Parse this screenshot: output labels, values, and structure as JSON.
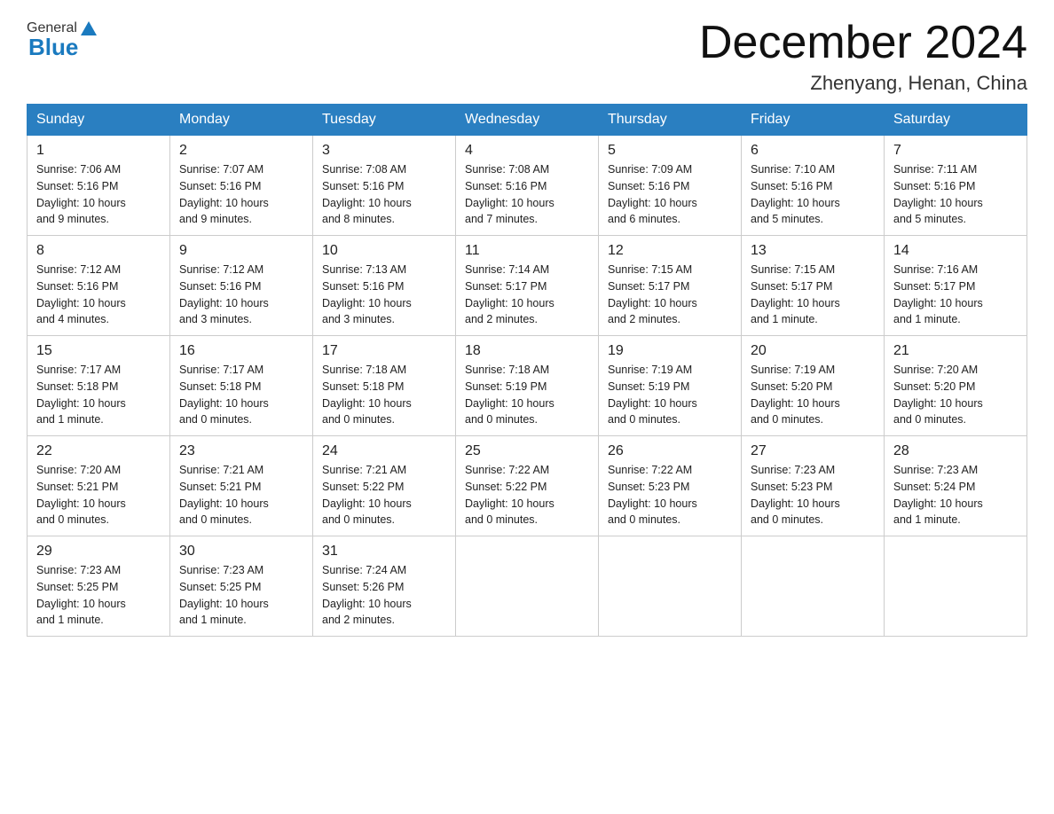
{
  "header": {
    "title": "December 2024",
    "location": "Zhenyang, Henan, China",
    "logo_general": "General",
    "logo_blue": "Blue"
  },
  "days_of_week": [
    "Sunday",
    "Monday",
    "Tuesday",
    "Wednesday",
    "Thursday",
    "Friday",
    "Saturday"
  ],
  "weeks": [
    [
      {
        "day": "1",
        "sunrise": "7:06 AM",
        "sunset": "5:16 PM",
        "daylight": "10 hours and 9 minutes."
      },
      {
        "day": "2",
        "sunrise": "7:07 AM",
        "sunset": "5:16 PM",
        "daylight": "10 hours and 9 minutes."
      },
      {
        "day": "3",
        "sunrise": "7:08 AM",
        "sunset": "5:16 PM",
        "daylight": "10 hours and 8 minutes."
      },
      {
        "day": "4",
        "sunrise": "7:08 AM",
        "sunset": "5:16 PM",
        "daylight": "10 hours and 7 minutes."
      },
      {
        "day": "5",
        "sunrise": "7:09 AM",
        "sunset": "5:16 PM",
        "daylight": "10 hours and 6 minutes."
      },
      {
        "day": "6",
        "sunrise": "7:10 AM",
        "sunset": "5:16 PM",
        "daylight": "10 hours and 5 minutes."
      },
      {
        "day": "7",
        "sunrise": "7:11 AM",
        "sunset": "5:16 PM",
        "daylight": "10 hours and 5 minutes."
      }
    ],
    [
      {
        "day": "8",
        "sunrise": "7:12 AM",
        "sunset": "5:16 PM",
        "daylight": "10 hours and 4 minutes."
      },
      {
        "day": "9",
        "sunrise": "7:12 AM",
        "sunset": "5:16 PM",
        "daylight": "10 hours and 3 minutes."
      },
      {
        "day": "10",
        "sunrise": "7:13 AM",
        "sunset": "5:16 PM",
        "daylight": "10 hours and 3 minutes."
      },
      {
        "day": "11",
        "sunrise": "7:14 AM",
        "sunset": "5:17 PM",
        "daylight": "10 hours and 2 minutes."
      },
      {
        "day": "12",
        "sunrise": "7:15 AM",
        "sunset": "5:17 PM",
        "daylight": "10 hours and 2 minutes."
      },
      {
        "day": "13",
        "sunrise": "7:15 AM",
        "sunset": "5:17 PM",
        "daylight": "10 hours and 1 minute."
      },
      {
        "day": "14",
        "sunrise": "7:16 AM",
        "sunset": "5:17 PM",
        "daylight": "10 hours and 1 minute."
      }
    ],
    [
      {
        "day": "15",
        "sunrise": "7:17 AM",
        "sunset": "5:18 PM",
        "daylight": "10 hours and 1 minute."
      },
      {
        "day": "16",
        "sunrise": "7:17 AM",
        "sunset": "5:18 PM",
        "daylight": "10 hours and 0 minutes."
      },
      {
        "day": "17",
        "sunrise": "7:18 AM",
        "sunset": "5:18 PM",
        "daylight": "10 hours and 0 minutes."
      },
      {
        "day": "18",
        "sunrise": "7:18 AM",
        "sunset": "5:19 PM",
        "daylight": "10 hours and 0 minutes."
      },
      {
        "day": "19",
        "sunrise": "7:19 AM",
        "sunset": "5:19 PM",
        "daylight": "10 hours and 0 minutes."
      },
      {
        "day": "20",
        "sunrise": "7:19 AM",
        "sunset": "5:20 PM",
        "daylight": "10 hours and 0 minutes."
      },
      {
        "day": "21",
        "sunrise": "7:20 AM",
        "sunset": "5:20 PM",
        "daylight": "10 hours and 0 minutes."
      }
    ],
    [
      {
        "day": "22",
        "sunrise": "7:20 AM",
        "sunset": "5:21 PM",
        "daylight": "10 hours and 0 minutes."
      },
      {
        "day": "23",
        "sunrise": "7:21 AM",
        "sunset": "5:21 PM",
        "daylight": "10 hours and 0 minutes."
      },
      {
        "day": "24",
        "sunrise": "7:21 AM",
        "sunset": "5:22 PM",
        "daylight": "10 hours and 0 minutes."
      },
      {
        "day": "25",
        "sunrise": "7:22 AM",
        "sunset": "5:22 PM",
        "daylight": "10 hours and 0 minutes."
      },
      {
        "day": "26",
        "sunrise": "7:22 AM",
        "sunset": "5:23 PM",
        "daylight": "10 hours and 0 minutes."
      },
      {
        "day": "27",
        "sunrise": "7:23 AM",
        "sunset": "5:23 PM",
        "daylight": "10 hours and 0 minutes."
      },
      {
        "day": "28",
        "sunrise": "7:23 AM",
        "sunset": "5:24 PM",
        "daylight": "10 hours and 1 minute."
      }
    ],
    [
      {
        "day": "29",
        "sunrise": "7:23 AM",
        "sunset": "5:25 PM",
        "daylight": "10 hours and 1 minute."
      },
      {
        "day": "30",
        "sunrise": "7:23 AM",
        "sunset": "5:25 PM",
        "daylight": "10 hours and 1 minute."
      },
      {
        "day": "31",
        "sunrise": "7:24 AM",
        "sunset": "5:26 PM",
        "daylight": "10 hours and 2 minutes."
      },
      null,
      null,
      null,
      null
    ]
  ],
  "labels": {
    "sunrise": "Sunrise:",
    "sunset": "Sunset:",
    "daylight": "Daylight:"
  }
}
